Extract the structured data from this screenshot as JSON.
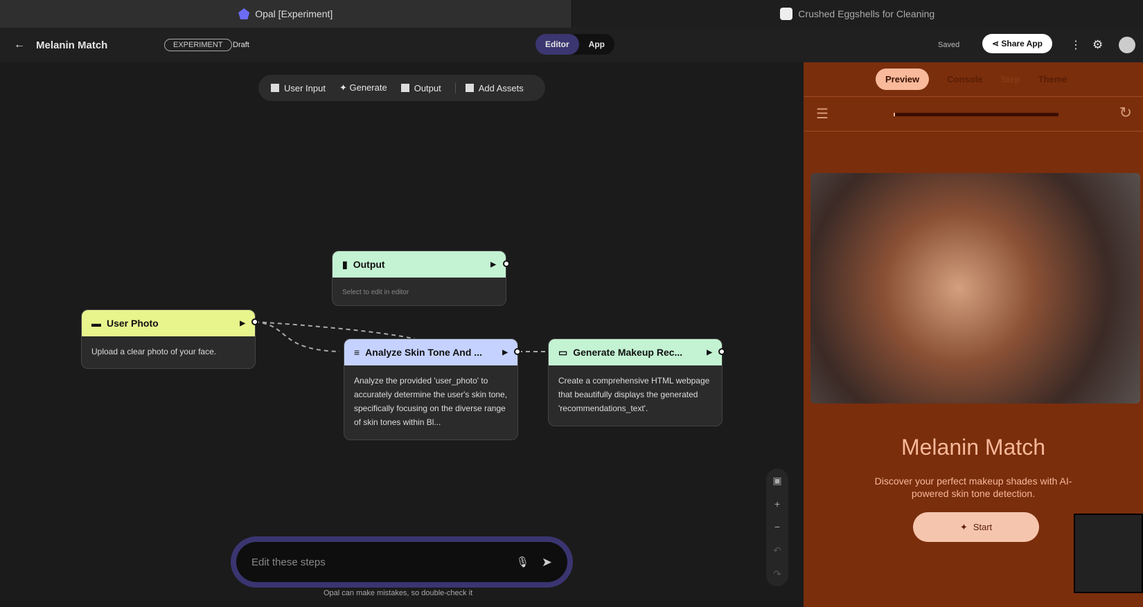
{
  "browser_tabs": [
    {
      "title": "Opal [Experiment]"
    },
    {
      "title": "Crushed Eggshells for Cleaning"
    }
  ],
  "header": {
    "title": "Melanin Match",
    "badge": "EXPERIMENT",
    "status": "Draft",
    "modes": [
      "Editor",
      "App"
    ],
    "saved": "Saved",
    "share": "Share App"
  },
  "toolbar": [
    "User Input",
    "Generate",
    "Output",
    "Add Assets"
  ],
  "nodes": {
    "output": {
      "title": "Output",
      "body": "Select to edit in editor",
      "color": "#c4f3d3"
    },
    "user_photo": {
      "title": "User Photo",
      "body": "Upload a clear photo of your face.",
      "color": "#e8f58d"
    },
    "analyze": {
      "title": "Analyze Skin Tone And ...",
      "body": "Analyze the provided 'user_photo' to accurately determine the user's skin tone, specifically focusing on the diverse range of skin tones within Bl...",
      "color": "#c5d2ff"
    },
    "generate": {
      "title": "Generate Makeup Rec...",
      "body": "Create a comprehensive HTML webpage that beautifully displays the generated 'recommendations_text'.",
      "color": "#c4f3d3"
    }
  },
  "chat": {
    "placeholder": "Edit these steps",
    "disclaimer": "Opal can make mistakes, so double-check it"
  },
  "preview": {
    "tabs": [
      "Preview",
      "Console",
      "Step",
      "Theme"
    ],
    "progress": 0.01,
    "app_title": "Melanin Match",
    "app_subtitle": "Discover your perfect makeup shades with AI-powered skin tone detection.",
    "start": "Start"
  }
}
